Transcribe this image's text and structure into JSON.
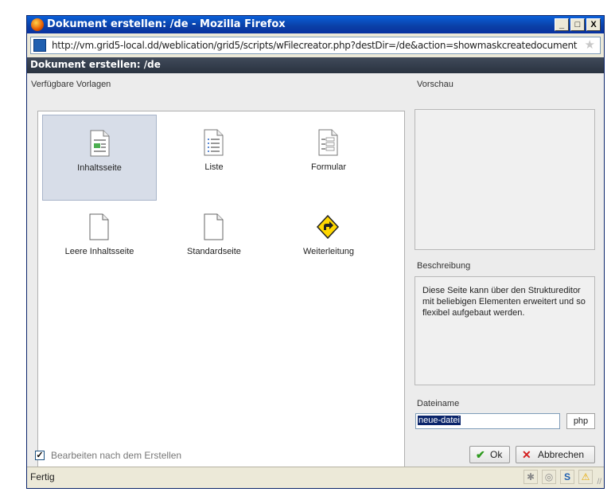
{
  "window": {
    "title": "Dokument erstellen: /de - Mozilla Firefox",
    "buttons": [
      "_",
      "□",
      "X"
    ]
  },
  "urlbar": {
    "url": "http://vm.grid5-local.dd/weblication/grid5/scripts/wFilecreator.php?destDir=/de&action=showmaskcreatedocument"
  },
  "dialog": {
    "heading": "Dokument erstellen: /de"
  },
  "templates": {
    "label": "Verfügbare Vorlagen",
    "items": [
      {
        "label": "Inhaltsseite",
        "icon": "page-content-icon",
        "selected": true
      },
      {
        "label": "Liste",
        "icon": "page-list-icon",
        "selected": false
      },
      {
        "label": "Formular",
        "icon": "page-form-icon",
        "selected": false
      },
      {
        "label": "Leere Inhaltsseite",
        "icon": "blank-page-icon",
        "selected": false
      },
      {
        "label": "Standardseite",
        "icon": "blank-page-icon",
        "selected": false
      },
      {
        "label": "Weiterleitung",
        "icon": "redirect-sign-icon",
        "selected": false
      }
    ]
  },
  "preview": {
    "label": "Vorschau"
  },
  "description": {
    "label": "Beschreibung",
    "text": "Diese Seite kann über den Struktureditor mit beliebigen Elementen erweitert und so flexibel aufgebaut werden."
  },
  "filename": {
    "label": "Dateiname",
    "value": "neue-datei",
    "extension": "php"
  },
  "options": {
    "edit_after_create": "Bearbeiten nach dem Erstellen",
    "checked": true
  },
  "actions": {
    "ok": "Ok",
    "cancel": "Abbrechen"
  },
  "status": {
    "text": "Fertig"
  },
  "colors": {
    "titlebar": "#0a3fa6",
    "dialog_header": "#2a3340",
    "selection": "#d7dde8",
    "ok_icon": "#2e9a1f",
    "cancel_icon": "#d42020"
  }
}
